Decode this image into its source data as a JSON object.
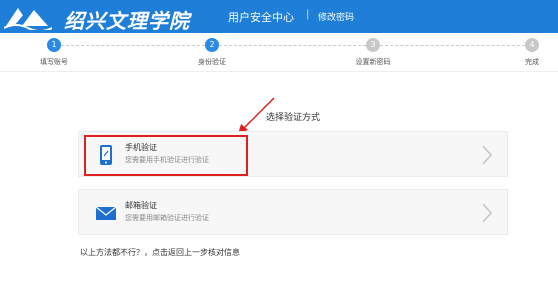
{
  "header": {
    "logo_text": "绍兴文理学院",
    "title": "用户安全中心",
    "separator": "|",
    "subtitle": "修改密码",
    "logo_icon": "school-emblem-icon"
  },
  "steps": [
    {
      "number": "1",
      "label": "填写账号",
      "state": "active"
    },
    {
      "number": "2",
      "label": "身份验证",
      "state": "active"
    },
    {
      "number": "3",
      "label": "设置新密码",
      "state": "inactive"
    },
    {
      "number": "4",
      "label": "完成",
      "state": "inactive"
    }
  ],
  "choose": {
    "title": "选择验证方式"
  },
  "options": [
    {
      "title": "手机验证",
      "desc": "您需要用手机验证进行验证",
      "icon": "mobile-phone-icon"
    },
    {
      "title": "邮箱验证",
      "desc": "您需要用邮箱验证进行验证",
      "icon": "envelope-icon"
    }
  ],
  "footer": {
    "text": "以上方法都不行？，点击返回上一步核对信息"
  },
  "colors": {
    "brand": "#1f7fd8",
    "step_active": "#2b8ae3",
    "step_inactive": "#c8c8c8",
    "highlight": "#e02020"
  }
}
